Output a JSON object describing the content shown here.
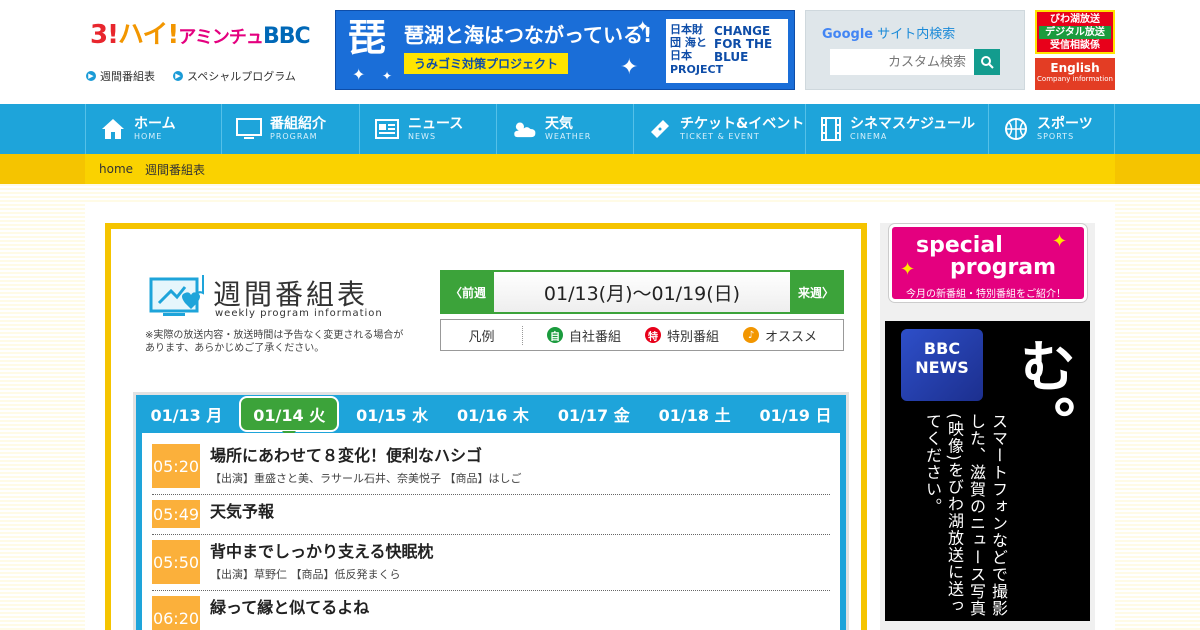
{
  "header": {
    "logo": {
      "p1": "3!",
      "p2": "ハイ!",
      "p3": "アミンチュ",
      "p4": "BBC"
    },
    "subnav": [
      "週間番組表",
      "スペシャルプログラム"
    ],
    "banner": {
      "kanji": "琵",
      "main": "琶湖と海はつながっている!",
      "sub": "うみゴミ対策プロジェクト",
      "right_a": "日本財団 海と日本 PROJECT",
      "right_b": "CHANGE FOR THE BLUE"
    },
    "search": {
      "title_brand": "Google",
      "title_rest": "サイト内検索",
      "placeholder": "カスタム検索"
    },
    "badge_red": {
      "line1": "びわ湖放送",
      "line2": "デジタル放送",
      "line3": "受信相談係"
    },
    "badge_en": {
      "line1": "English",
      "line2": "Company information"
    }
  },
  "nav": [
    {
      "ja": "ホーム",
      "en": "HOME",
      "icon": "home-icon"
    },
    {
      "ja": "番組紹介",
      "en": "PROGRAM",
      "icon": "tv-icon"
    },
    {
      "ja": "ニュース",
      "en": "NEWS",
      "icon": "newspaper-icon"
    },
    {
      "ja": "天気",
      "en": "WEATHER",
      "icon": "weather-icon"
    },
    {
      "ja": "チケット&イベント",
      "en": "TICKET & EVENT",
      "icon": "ticket-icon"
    },
    {
      "ja": "シネマスケジュール",
      "en": "CINEMA",
      "icon": "film-icon"
    },
    {
      "ja": "スポーツ",
      "en": "SPORTS",
      "icon": "ball-icon"
    }
  ],
  "breadcrumb": {
    "home": "home",
    "current": "週間番組表"
  },
  "schedule": {
    "title": "週間番組表",
    "title_en": "weekly program information",
    "note": "※実際の放送内容・放送時間は予告なく変更される場合があります、あらかじめご了承ください。",
    "prev_label": "前週",
    "next_label": "来週",
    "range": "01/13(月)～01/19(日)",
    "legend": {
      "label": "凡例",
      "items": [
        {
          "mark": "自",
          "text": "自社番組",
          "color": "#1a9b3d"
        },
        {
          "mark": "特",
          "text": "特別番組",
          "color": "#e8001a"
        },
        {
          "mark": "♪",
          "text": "オススメ",
          "color": "#f29600"
        }
      ]
    },
    "days": [
      "01/13 月",
      "01/14 火",
      "01/15 水",
      "01/16 木",
      "01/17 金",
      "01/18 土",
      "01/19 日"
    ],
    "active_day": "01/14 火",
    "programs": [
      {
        "time": "05:20",
        "title": "場所にあわせて８変化！便利なハシゴ",
        "desc": "【出演】重盛さと美、ラサール石井、奈美悦子 【商品】はしご"
      },
      {
        "time": "05:49",
        "title": "天気予報",
        "desc": ""
      },
      {
        "time": "05:50",
        "title": "背中までしっかり支える快眠枕",
        "desc": "【出演】草野仁 【商品】低反発まくら"
      },
      {
        "time": "06:20",
        "title": "緑って縁と似てるよね",
        "desc": ""
      }
    ]
  },
  "sidebar": {
    "special": {
      "line1": "special",
      "line2": "program",
      "caption": "今月の新番組・特別番組をご紹介！"
    },
    "news": {
      "logo1": "BBC",
      "logo2": "NEWS",
      "big": "写真求む。",
      "small": "スマートフォンなどで撮影した、滋賀のニュース写真(映像)をびわ湖放送に送ってください。"
    }
  }
}
